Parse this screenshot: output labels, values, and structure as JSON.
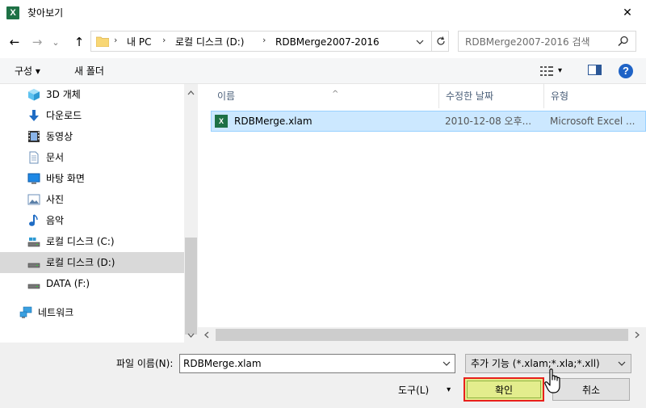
{
  "window": {
    "title": "찾아보기",
    "app_icon_letter": "X",
    "close_glyph": "✕"
  },
  "nav": {
    "back_glyph": "←",
    "forward_glyph": "→",
    "recent_glyph": "⌄",
    "up_glyph": "↑"
  },
  "address": {
    "crumbs": [
      "내 PC",
      "로컬 디스크 (D:)",
      "RDBMerge2007-2016"
    ],
    "separator": "›"
  },
  "search": {
    "placeholder": "RDBMerge2007-2016 검색"
  },
  "toolbar": {
    "organize_label": "구성 ▾",
    "new_folder_label": "새 폴더",
    "view_caret": "▾",
    "help_glyph": "?"
  },
  "nav_pane": {
    "items": [
      {
        "label": "3D 개체",
        "icon": "cube-3d-icon"
      },
      {
        "label": "다운로드",
        "icon": "download-arrow-icon"
      },
      {
        "label": "동영상",
        "icon": "film-icon"
      },
      {
        "label": "문서",
        "icon": "document-icon"
      },
      {
        "label": "바탕 화면",
        "icon": "desktop-icon"
      },
      {
        "label": "사진",
        "icon": "picture-icon"
      },
      {
        "label": "음악",
        "icon": "music-note-icon"
      },
      {
        "label": "로컬 디스크 (C:)",
        "icon": "drive-icon"
      },
      {
        "label": "로컬 디스크 (D:)",
        "icon": "drive-icon",
        "selected": true
      },
      {
        "label": "DATA (F:)",
        "icon": "drive-icon"
      },
      {
        "label": "네트워크",
        "icon": "network-icon"
      }
    ]
  },
  "file_list": {
    "columns": [
      "이름",
      "수정한 날짜",
      "유형"
    ],
    "sort_caret": "^",
    "rows": [
      {
        "name": "RDBMerge.xlam",
        "modified": "2010-12-08 오후...",
        "type": "Microsoft Excel ...",
        "icon_letter": "X"
      }
    ]
  },
  "bottom": {
    "file_name_label": "파일 이름(N):",
    "file_name_value": "RDBMerge.xlam",
    "filter_value": "추가 기능 (*.xlam;*.xla;*.xll)",
    "tools_label": "도구(L)",
    "tools_caret": "▾",
    "ok_label": "확인",
    "cancel_label": "취소"
  },
  "colors": {
    "excel_green": "#1e7145",
    "selection_blue": "#cce8ff",
    "ok_highlight": "#e3ed8d",
    "ok_border_red": "#e8201c",
    "help_blue": "#1f63c6"
  }
}
